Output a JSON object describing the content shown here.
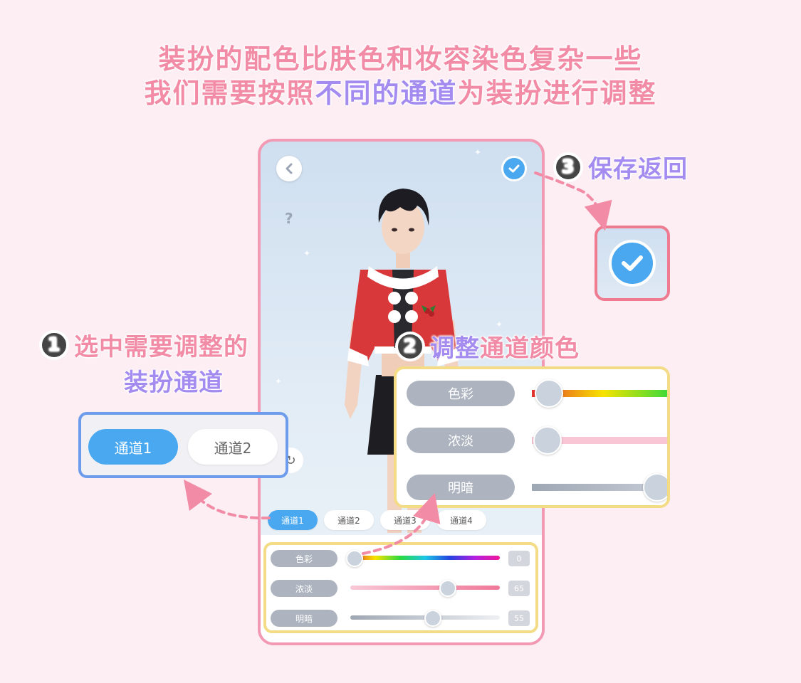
{
  "headline": {
    "line1": "装扮的配色比肤色和妆容染色复杂一些",
    "line2_part1": "我们需要按照",
    "line2_part2": "不同的通道",
    "line2_part3": "为装扮进行调整"
  },
  "phone": {
    "help_glyph": "?",
    "channel_tabs": [
      "通道1",
      "通道2",
      "通道3",
      "通道4"
    ],
    "active_channel": "通道1",
    "sliders": [
      {
        "label": "色彩",
        "value": "0",
        "level": 0.03
      },
      {
        "label": "浓淡",
        "value": "65",
        "level": 0.65
      },
      {
        "label": "明暗",
        "value": "55",
        "level": 0.55
      }
    ]
  },
  "callouts": {
    "step1_number": "1",
    "step1_line1": "选中需要调整的",
    "step1_line2": "装扮通道",
    "step2_number": "2",
    "step2_part1": "调整",
    "step2_part2": "通道颜色",
    "step3_number": "3",
    "step3_text": "保存返回"
  },
  "channel_zoom": {
    "option1": "通道1",
    "option2": "通道2"
  },
  "slider_zoom": {
    "rows": [
      "色彩",
      "浓淡",
      "明暗"
    ]
  },
  "colors": {
    "pink_text": "#f28ba5",
    "violet_text": "#a48bf0",
    "accent_blue": "#4aa8f0",
    "frame_pink": "#f29ab3",
    "highlight_yellow": "#f3dc85",
    "highlight_blue": "#6e9cec"
  }
}
